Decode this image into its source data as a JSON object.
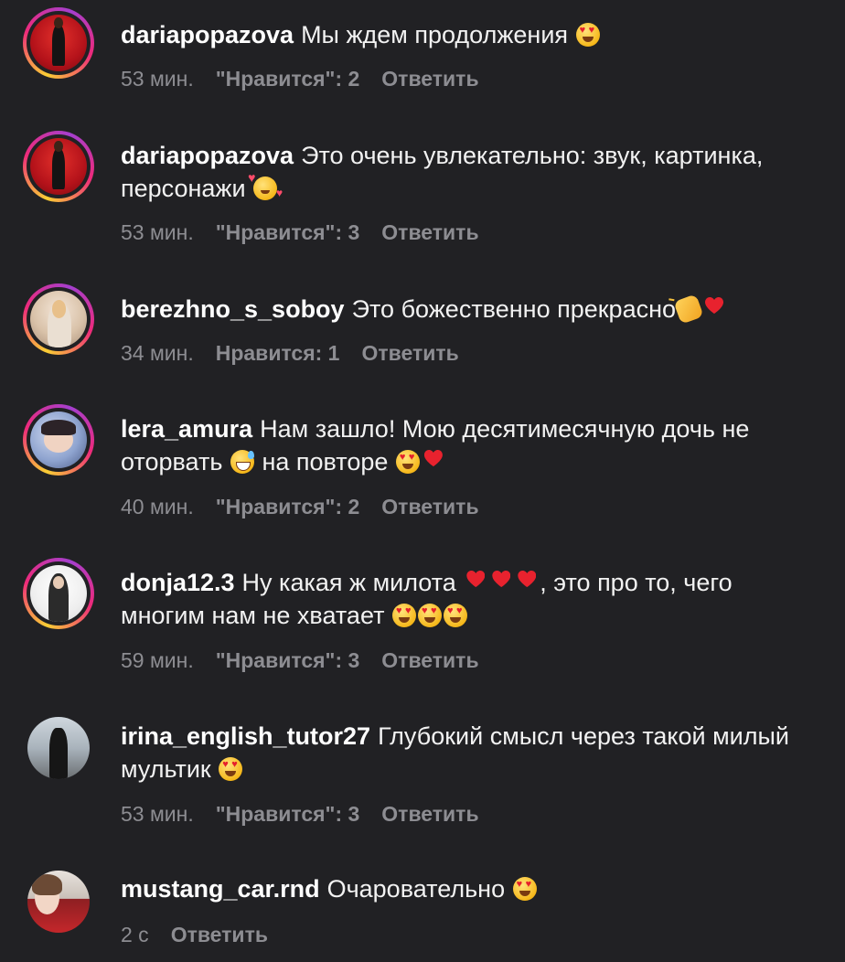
{
  "comments": [
    {
      "username": "dariapopazova",
      "text": "Мы ждем продолжения",
      "emojis": [
        "smiling-face-with-heart-eyes"
      ],
      "time": "53 мин.",
      "likes": "\"Нравится\": 2",
      "reply": "Ответить",
      "avatar": "woman-red-curtain",
      "story_ring": true
    },
    {
      "username": "dariapopazova",
      "text_line1": "Это очень увлекательно: звук, картинка,",
      "text_line2": "персонажи",
      "emojis": [
        "smiling-face-with-hearts"
      ],
      "time": "53 мин.",
      "likes": "\"Нравится\": 3",
      "reply": "Ответить",
      "avatar": "woman-red-curtain",
      "story_ring": true
    },
    {
      "username": "berezhno_s_soboy",
      "text": "Это божественно прекрасно",
      "emojis": [
        "clapping-hands",
        "red-heart"
      ],
      "time": "34 мин.",
      "likes": "Нравится: 1",
      "reply": "Ответить",
      "avatar": "woman-light-room",
      "story_ring": true
    },
    {
      "username": "lera_amura",
      "text_part1": "Нам зашло! Мою десятимесячную дочь не",
      "text_part2": "оторвать",
      "text_part3": "на повторе",
      "emojis": [
        "grinning-face-with-sweat",
        "smiling-face-with-heart-eyes",
        "red-heart"
      ],
      "time": "40 мин.",
      "likes": "\"Нравится\": 2",
      "reply": "Ответить",
      "avatar": "woman-blue-background",
      "story_ring": true
    },
    {
      "username": "donja12.3",
      "text_part1": "Ну какая ж милота",
      "text_part2": ", это про то, чего",
      "text_part3": "многим нам не хватает",
      "emojis": [
        "red-heart",
        "red-heart",
        "red-heart",
        "smiling-face-with-heart-eyes",
        "smiling-face-with-heart-eyes",
        "smiling-face-with-heart-eyes"
      ],
      "time": "59 мин.",
      "likes": "\"Нравится\": 3",
      "reply": "Ответить",
      "avatar": "woman-white-background",
      "story_ring": true
    },
    {
      "username": "irina_english_tutor27",
      "text_line1": "Глубокий смысл через такой милый",
      "text_line2": "мультик",
      "emojis": [
        "smiling-face-with-heart-eyes"
      ],
      "time": "53 мин.",
      "likes": "\"Нравится\": 3",
      "reply": "Ответить",
      "avatar": "woman-street",
      "story_ring": false
    },
    {
      "username": "mustang_car.rnd",
      "text": "Очаровательно",
      "emojis": [
        "smiling-face-with-heart-eyes"
      ],
      "time": "2 с",
      "reply": "Ответить",
      "avatar": "woman-red-car",
      "story_ring": false
    }
  ],
  "colors": {
    "background": "#212124",
    "text": "#f2f2f2",
    "meta": "#8d8d92",
    "heart": "#e8222e"
  }
}
